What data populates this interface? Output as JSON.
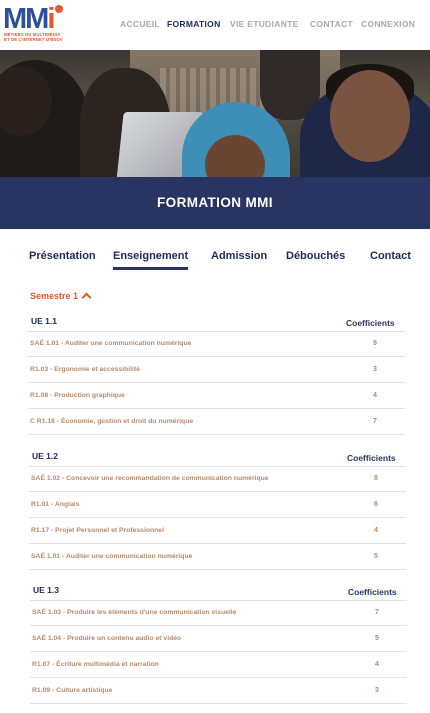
{
  "logo": {
    "mark": "MM",
    "mark_i": "i",
    "sub_line1": "Métiers du multimédia",
    "sub_line2": "et de l'internet u'bsov"
  },
  "nav": {
    "items": [
      "ACCUEIL",
      "FORMATION",
      "VIE ETUDIANTE",
      "CONTACT",
      "CONNEXION"
    ],
    "active": "FORMATION"
  },
  "banner": {
    "title": "FORMATION MMI"
  },
  "tabs": [
    "Présentation",
    "Enseignement",
    "Admission",
    "Débouchés",
    "Contact"
  ],
  "active_tab": "Enseignement",
  "semester": {
    "label": "Semestre 1"
  },
  "coef_label": "Coefficients",
  "ues": [
    {
      "title": "UE 1.1",
      "rows": [
        {
          "label": "SAÉ 1.01 - Auditer une communication numérique",
          "coef": "9"
        },
        {
          "label": "R1.03 - Ergonomie et accessibilité",
          "coef": "3"
        },
        {
          "label": "R1.08 - Production graphique",
          "coef": "4"
        },
        {
          "label": "C R1.16 - Économie, gestion et droit du numérique",
          "coef": "7"
        }
      ]
    },
    {
      "title": "UE 1.2",
      "rows": [
        {
          "label": "SAÉ 1.02 - Concevoir une recommandation de communication numérique",
          "coef": "8"
        },
        {
          "label": "R1.01 - Anglais",
          "coef": "6"
        },
        {
          "label": "R1.17 - Projet Personnel et Professionnel",
          "coef": "4"
        },
        {
          "label": "SAÉ 1.01 - Auditer une communication numérique",
          "coef": "5"
        }
      ]
    },
    {
      "title": "UE 1.3",
      "rows": [
        {
          "label": "SAÉ 1.03 - Produire les éléments d'une communication visuelle",
          "coef": "7"
        },
        {
          "label": "SAÉ 1.04 - Produire un contenu audio et vidéo",
          "coef": "5"
        },
        {
          "label": "R1.07 - Écriture multimédia et narration",
          "coef": "4"
        },
        {
          "label": "R1.09 - Culture artistique",
          "coef": "3"
        }
      ]
    }
  ],
  "colors": {
    "navy": "#2a3463",
    "accent": "#e8572a",
    "row_text": "#b58a6d",
    "nav_inactive": "#a7a9b4"
  }
}
